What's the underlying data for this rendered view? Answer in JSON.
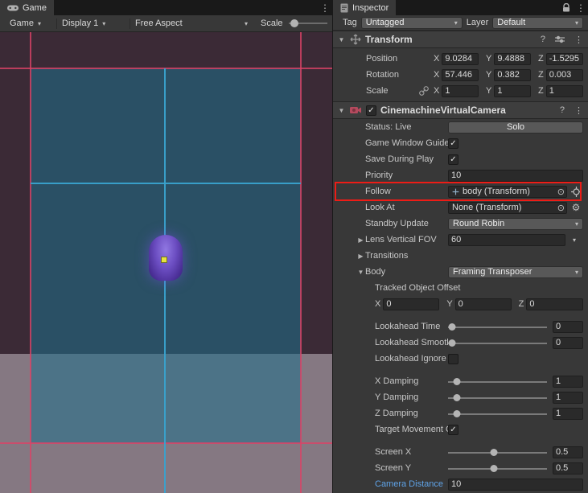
{
  "icons": {
    "caret_down": "▾",
    "fold_open": "▼",
    "fold_closed": "▶",
    "kebab": "⋮",
    "check": "✓",
    "picker": "⊙",
    "gear": "⚙",
    "help": "?"
  },
  "colors": {
    "highlight_red": "#ed1c16",
    "modified_blue": "#5fa3e7",
    "softzone_teal": "#2b7189",
    "guide_pink": "#d94368",
    "guide_cyan": "#34a0cd",
    "character_purple": "#6a4cc0"
  },
  "game": {
    "tab_label": "Game",
    "toolbar": {
      "view": "Game",
      "display": "Display 1",
      "aspect": "Free Aspect",
      "scale_label": "Scale"
    }
  },
  "inspector": {
    "tab_label": "Inspector",
    "tag_label": "Tag",
    "tag_value": "Untagged",
    "layer_label": "Layer",
    "layer_value": "Default",
    "transform": {
      "title": "Transform",
      "axis": {
        "x": "X",
        "y": "Y",
        "z": "Z"
      },
      "position": {
        "label": "Position",
        "x": "9.0284",
        "y": "9.4888",
        "z": "-1.5295"
      },
      "rotation": {
        "label": "Rotation",
        "x": "57.446",
        "y": "0.382",
        "z": "0.003"
      },
      "scale": {
        "label": "Scale",
        "x": "1",
        "y": "1",
        "z": "1"
      }
    },
    "vcam": {
      "title": "CinemachineVirtualCamera",
      "status_label": "Status: Live",
      "solo_button": "Solo",
      "guides_label": "Game Window Guides",
      "save_label": "Save During Play",
      "priority_label": "Priority",
      "priority_value": "10",
      "follow_label": "Follow",
      "follow_value": "body (Transform)",
      "lookat_label": "Look At",
      "lookat_value": "None (Transform)",
      "standby_label": "Standby Update",
      "standby_value": "Round Robin",
      "lens_label": "Lens Vertical FOV",
      "lens_value": "60",
      "transitions_label": "Transitions",
      "body_label": "Body",
      "body_value": "Framing Transposer",
      "offset_label": "Tracked Object Offset",
      "offset_x": "0",
      "offset_y": "0",
      "offset_z": "0",
      "lookahead_time_label": "Lookahead Time",
      "lookahead_time_value": "0",
      "lookahead_smoothing_label": "Lookahead Smoothing",
      "lookahead_smoothing_value": "0",
      "lookahead_ignore_label": "Lookahead Ignore Y",
      "x_damping_label": "X Damping",
      "x_damping_value": "1",
      "y_damping_label": "Y Damping",
      "y_damping_value": "1",
      "z_damping_label": "Z Damping",
      "z_damping_value": "1",
      "target_movement_label": "Target Movement Only",
      "screen_x_label": "Screen X",
      "screen_x_value": "0.5",
      "screen_y_label": "Screen Y",
      "screen_y_value": "0.5",
      "camera_distance_label": "Camera Distance",
      "camera_distance_value": "10"
    }
  }
}
